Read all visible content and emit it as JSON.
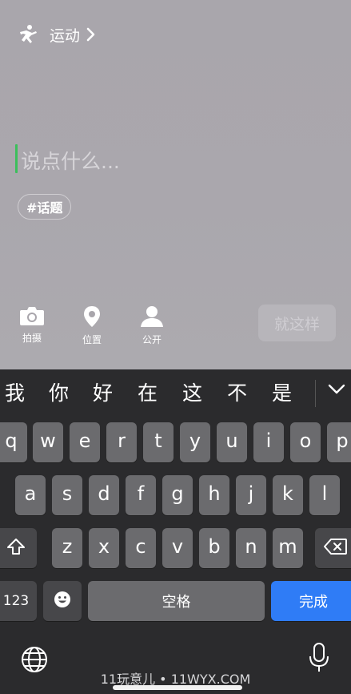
{
  "header": {
    "sport_icon": "running-person-icon",
    "title": "运动",
    "chevron": "chevron-right-icon"
  },
  "composer": {
    "placeholder": "说点什么...",
    "topic_tag": "#话题",
    "caret_color": "#3cbf5c"
  },
  "tools": [
    {
      "icon": "camera-icon",
      "label": "拍摄"
    },
    {
      "icon": "location-pin-icon",
      "label": "位置"
    },
    {
      "icon": "person-icon",
      "label": "公开"
    }
  ],
  "submit_label": "就这样",
  "keyboard": {
    "candidates": [
      "我",
      "你",
      "好",
      "在",
      "这",
      "不",
      "是"
    ],
    "row1": [
      "q",
      "w",
      "e",
      "r",
      "t",
      "y",
      "u",
      "i",
      "o",
      "p"
    ],
    "row2": [
      "a",
      "s",
      "d",
      "f",
      "g",
      "h",
      "j",
      "k",
      "l"
    ],
    "row3": [
      "z",
      "x",
      "c",
      "v",
      "b",
      "n",
      "m"
    ],
    "numbers_label": "123",
    "space_label": "空格",
    "return_label": "完成",
    "accent_color": "#2f7cf6"
  },
  "watermark": "11玩意儿 • 11WYX.COM"
}
